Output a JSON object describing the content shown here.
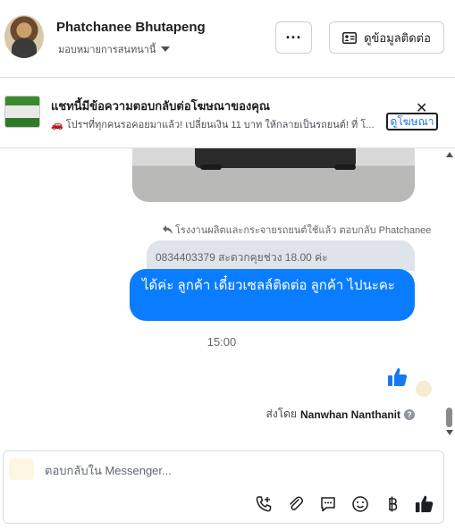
{
  "header": {
    "name": "Phatchanee Bhutapeng",
    "assign_label": "มอบหมายการสนทนานี้",
    "more_label": "···",
    "info_button": "ดูข้อมูลติดต่อ"
  },
  "ad": {
    "title": "แชทนี้มีข้อความตอบกลับต่อโฆษณาของคุณ",
    "text": "🚗 โปรฯที่ทุกคนรอคอยมาแล้ว! เปลี่ยนเงิน 11 บาท ให้กลายเป็นรถยนต์! ที่ โ...",
    "link": "ดูโฆษณา",
    "close": "✕"
  },
  "chat": {
    "reply_meta": "โรงงานผลิตและกระจายรถยนต์ใช้แล้ว ตอบกลับ Phatchanee",
    "quoted_text": "0834403379 สะดวกคุยช่วง 18.00 ค่ะ",
    "bubble_text": "ได้ค่ะ ลูกค้า  เดี๋ยวเซลล์ติดต่อ ลูกค้า  ไปนะคะ",
    "time": "15:00",
    "sent_by_prefix": "ส่งโดย",
    "sent_by_name": "Nanwhan Nanthanit",
    "help_glyph": "?"
  },
  "composer": {
    "placeholder": "ตอบกลับใน Messenger..."
  },
  "colors": {
    "bubble": "#0a7cff",
    "quoted": "#dfe3ea",
    "link": "#1877f2",
    "like": "#1877f2"
  },
  "icons": {
    "toolbar": [
      "phone-plus-icon",
      "paperclip-icon",
      "saved-reply-icon",
      "emoji-icon",
      "baht-icon",
      "thumbs-up-icon"
    ]
  }
}
